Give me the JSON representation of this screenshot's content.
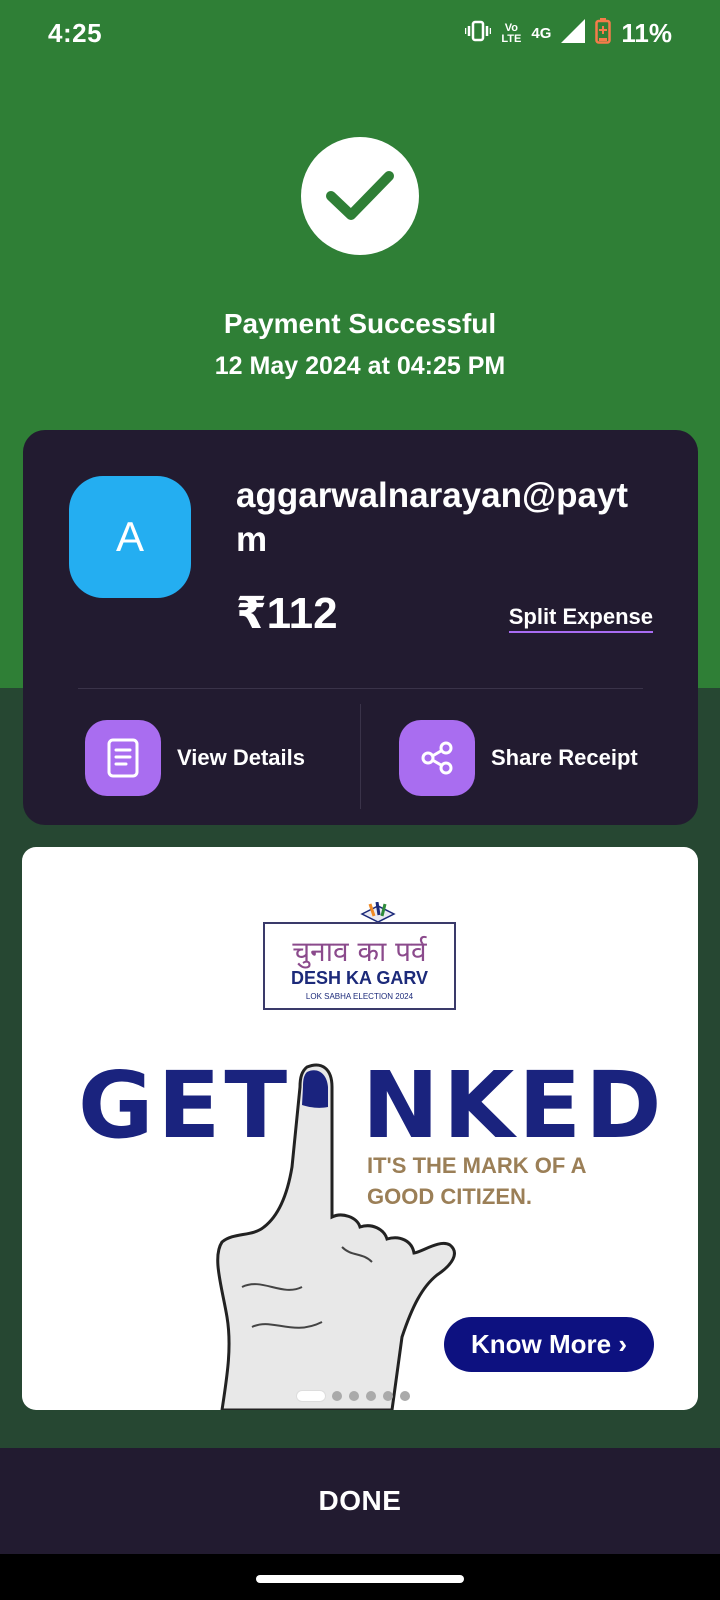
{
  "status_bar": {
    "time": "4:25",
    "network_label_top": "Vo",
    "network_label_bottom": "LTE",
    "network_type": "4G",
    "battery_percent": "11%",
    "battery_level": 0.11
  },
  "header": {
    "title": "Payment Successful",
    "datetime": "12 May 2024 at 04:25 PM",
    "background_color": "#2f7f36"
  },
  "payee": {
    "avatar_letter": "A",
    "upi_id": "aggarwalnarayan@paytm",
    "amount": "₹112",
    "split_label": "Split Expense",
    "avatar_color": "#24aef1"
  },
  "actions": [
    {
      "label": "View Details",
      "icon": "document-icon"
    },
    {
      "label": "Share Receipt",
      "icon": "share-icon"
    }
  ],
  "banner": {
    "logo_hindi": "चुनाव का पर्व",
    "logo_english": "DESH KA GARV",
    "logo_small": "LOK SABHA ELECTION 2024",
    "headline_left": "GET",
    "headline_right": "NKED",
    "tagline_1": "IT'S THE MARK OF A",
    "tagline_2": "GOOD CITIZEN.",
    "cta": "Know More ›",
    "slide_count": 6,
    "active_slide": 1
  },
  "footer": {
    "done_label": "DONE"
  }
}
